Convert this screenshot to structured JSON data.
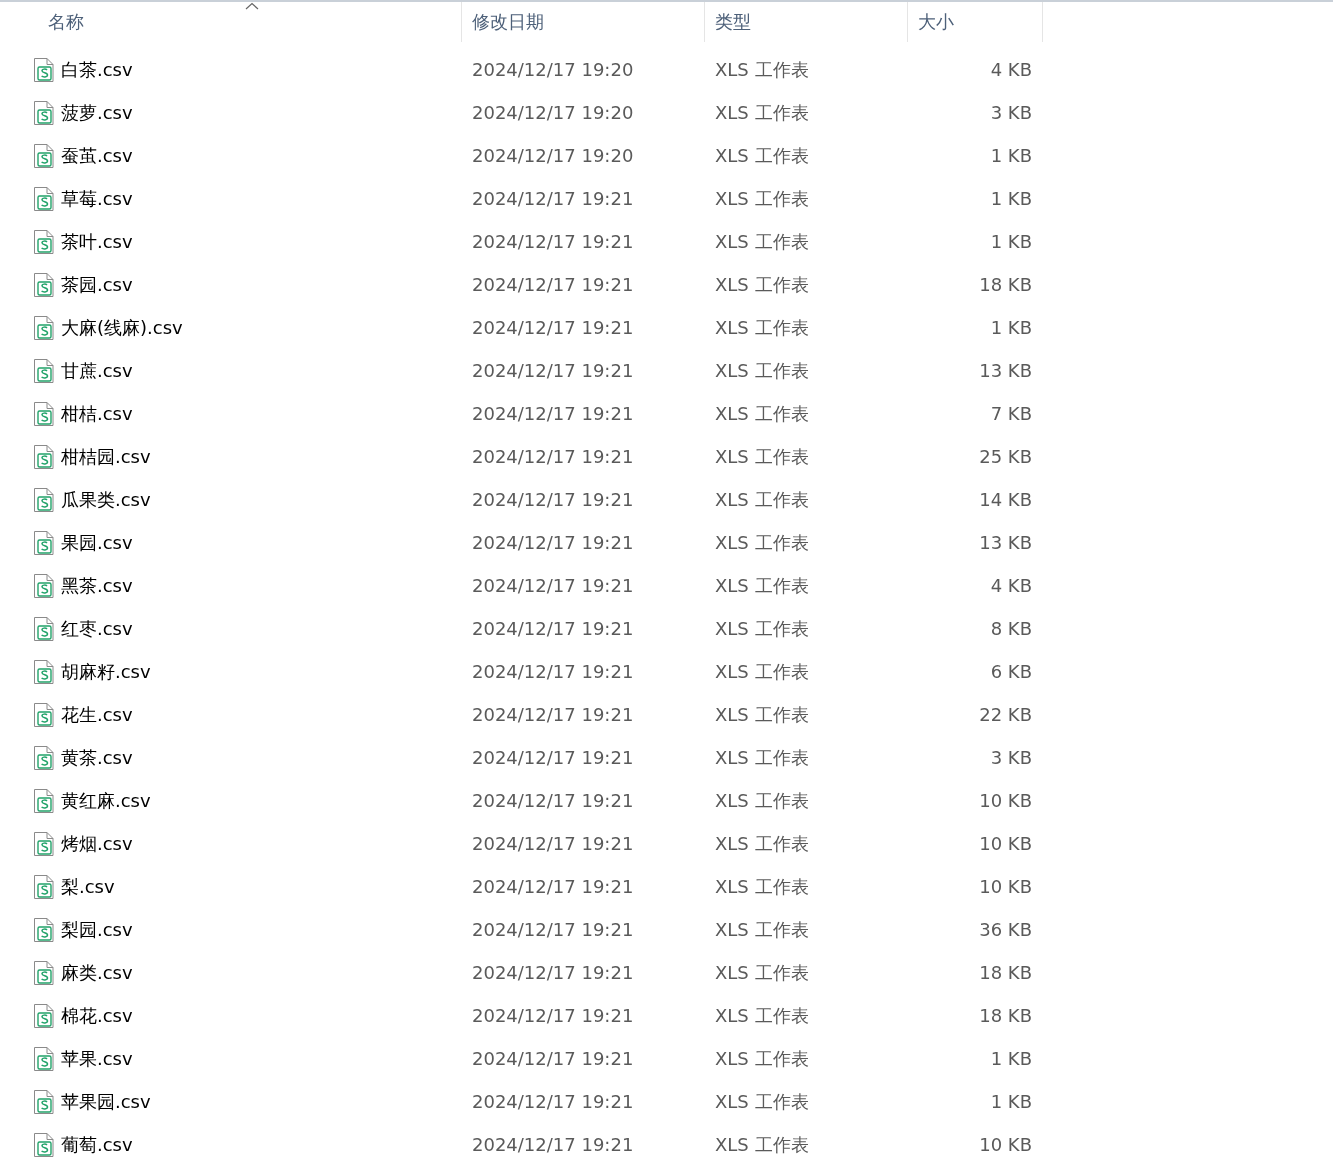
{
  "columns": [
    {
      "label": "名称",
      "sorted": true
    },
    {
      "label": "修改日期",
      "sorted": false
    },
    {
      "label": "类型",
      "sorted": false
    },
    {
      "label": "大小",
      "sorted": false
    }
  ],
  "files": [
    {
      "name": "白茶.csv",
      "modified": "2024/12/17 19:20",
      "type": "XLS 工作表",
      "size": "4 KB"
    },
    {
      "name": "菠萝.csv",
      "modified": "2024/12/17 19:20",
      "type": "XLS 工作表",
      "size": "3 KB"
    },
    {
      "name": "蚕茧.csv",
      "modified": "2024/12/17 19:20",
      "type": "XLS 工作表",
      "size": "1 KB"
    },
    {
      "name": "草莓.csv",
      "modified": "2024/12/17 19:21",
      "type": "XLS 工作表",
      "size": "1 KB"
    },
    {
      "name": "茶叶.csv",
      "modified": "2024/12/17 19:21",
      "type": "XLS 工作表",
      "size": "1 KB"
    },
    {
      "name": "茶园.csv",
      "modified": "2024/12/17 19:21",
      "type": "XLS 工作表",
      "size": "18 KB"
    },
    {
      "name": "大麻(线麻).csv",
      "modified": "2024/12/17 19:21",
      "type": "XLS 工作表",
      "size": "1 KB"
    },
    {
      "name": "甘蔗.csv",
      "modified": "2024/12/17 19:21",
      "type": "XLS 工作表",
      "size": "13 KB"
    },
    {
      "name": "柑桔.csv",
      "modified": "2024/12/17 19:21",
      "type": "XLS 工作表",
      "size": "7 KB"
    },
    {
      "name": "柑桔园.csv",
      "modified": "2024/12/17 19:21",
      "type": "XLS 工作表",
      "size": "25 KB"
    },
    {
      "name": "瓜果类.csv",
      "modified": "2024/12/17 19:21",
      "type": "XLS 工作表",
      "size": "14 KB"
    },
    {
      "name": "果园.csv",
      "modified": "2024/12/17 19:21",
      "type": "XLS 工作表",
      "size": "13 KB"
    },
    {
      "name": "黑茶.csv",
      "modified": "2024/12/17 19:21",
      "type": "XLS 工作表",
      "size": "4 KB"
    },
    {
      "name": "红枣.csv",
      "modified": "2024/12/17 19:21",
      "type": "XLS 工作表",
      "size": "8 KB"
    },
    {
      "name": "胡麻籽.csv",
      "modified": "2024/12/17 19:21",
      "type": "XLS 工作表",
      "size": "6 KB"
    },
    {
      "name": "花生.csv",
      "modified": "2024/12/17 19:21",
      "type": "XLS 工作表",
      "size": "22 KB"
    },
    {
      "name": "黄茶.csv",
      "modified": "2024/12/17 19:21",
      "type": "XLS 工作表",
      "size": "3 KB"
    },
    {
      "name": "黄红麻.csv",
      "modified": "2024/12/17 19:21",
      "type": "XLS 工作表",
      "size": "10 KB"
    },
    {
      "name": "烤烟.csv",
      "modified": "2024/12/17 19:21",
      "type": "XLS 工作表",
      "size": "10 KB"
    },
    {
      "name": "梨.csv",
      "modified": "2024/12/17 19:21",
      "type": "XLS 工作表",
      "size": "10 KB"
    },
    {
      "name": "梨园.csv",
      "modified": "2024/12/17 19:21",
      "type": "XLS 工作表",
      "size": "36 KB"
    },
    {
      "name": "麻类.csv",
      "modified": "2024/12/17 19:21",
      "type": "XLS 工作表",
      "size": "18 KB"
    },
    {
      "name": "棉花.csv",
      "modified": "2024/12/17 19:21",
      "type": "XLS 工作表",
      "size": "18 KB"
    },
    {
      "name": "苹果.csv",
      "modified": "2024/12/17 19:21",
      "type": "XLS 工作表",
      "size": "1 KB"
    },
    {
      "name": "苹果园.csv",
      "modified": "2024/12/17 19:21",
      "type": "XLS 工作表",
      "size": "1 KB"
    },
    {
      "name": "葡萄.csv",
      "modified": "2024/12/17 19:21",
      "type": "XLS 工作表",
      "size": "10 KB"
    }
  ]
}
